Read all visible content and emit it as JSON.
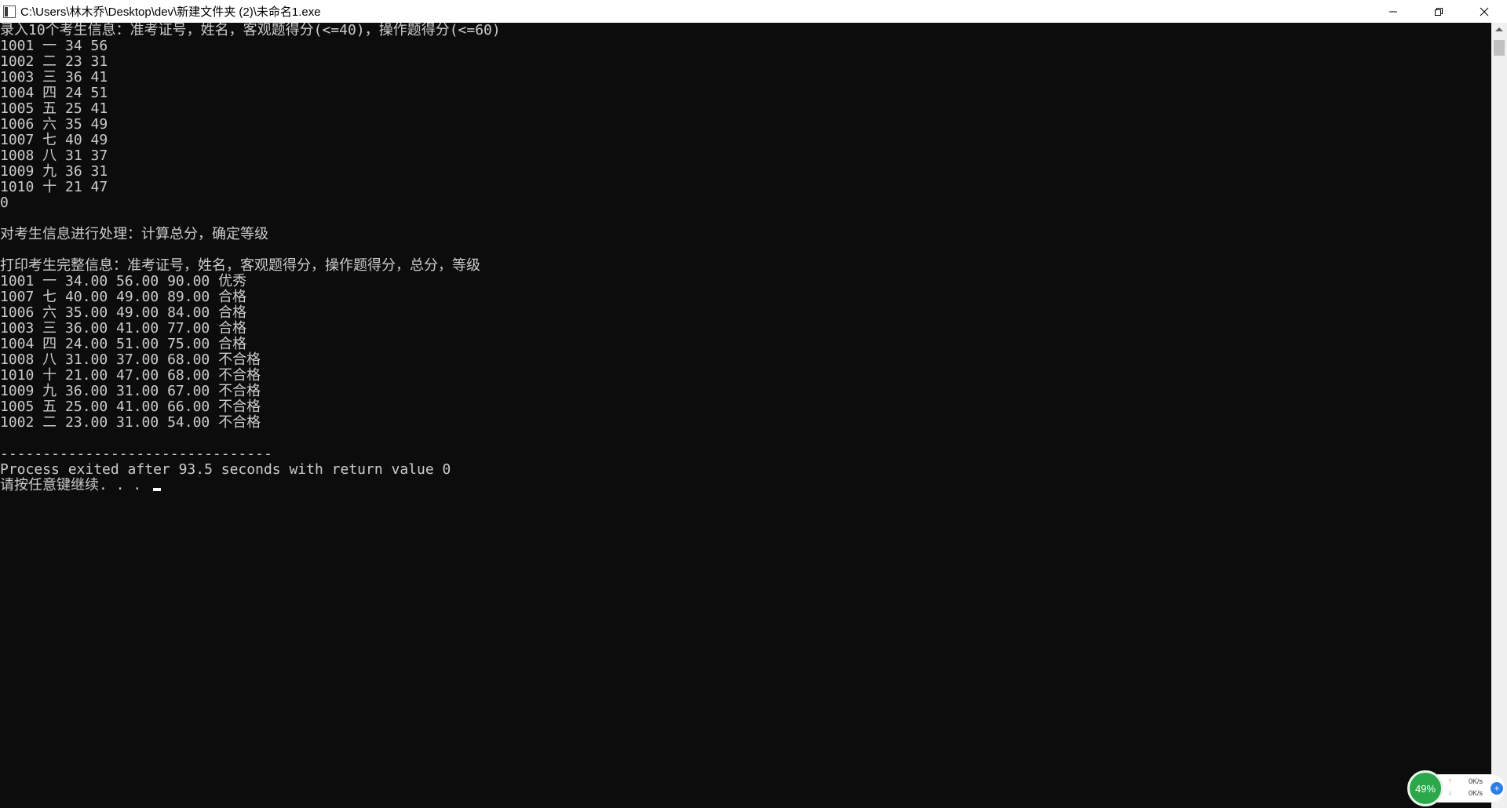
{
  "window": {
    "title": "C:\\Users\\林木乔\\Desktop\\dev\\新建文件夹 (2)\\未命名1.exe",
    "controls": {
      "minimize": "minimize-icon",
      "maximize": "restore-icon",
      "close": "close-icon"
    }
  },
  "console": {
    "lines": [
      "录入10个考生信息：准考证号，姓名，客观题得分(<=40)，操作题得分(<=60)",
      "1001 一 34 56",
      "1002 二 23 31",
      "1003 三 36 41",
      "1004 四 24 51",
      "1005 五 25 41",
      "1006 六 35 49",
      "1007 七 40 49",
      "1008 八 31 37",
      "1009 九 36 31",
      "1010 十 21 47",
      "0",
      "",
      "对考生信息进行处理：计算总分，确定等级",
      "",
      "打印考生完整信息：准考证号，姓名，客观题得分，操作题得分，总分，等级",
      "1001 一 34.00 56.00 90.00 优秀",
      "1007 七 40.00 49.00 89.00 合格",
      "1006 六 35.00 49.00 84.00 合格",
      "1003 三 36.00 41.00 77.00 合格",
      "1004 四 24.00 51.00 75.00 合格",
      "1008 八 31.00 37.00 68.00 不合格",
      "1010 十 21.00 47.00 68.00 不合格",
      "1009 九 36.00 31.00 67.00 不合格",
      "1005 五 25.00 41.00 66.00 不合格",
      "1002 二 23.00 31.00 54.00 不合格",
      "",
      "--------------------------------",
      "Process exited after 93.5 seconds with return value 0",
      "请按任意键继续. . . "
    ]
  },
  "net_widget": {
    "percent": "49%",
    "up_speed": "0K/s",
    "down_speed": "0K/s",
    "up_arrow": "↑",
    "down_arrow": "↓",
    "plus": "+"
  },
  "colors": {
    "console_bg": "#0c0c0c",
    "console_text": "#cccccc",
    "titlebar_bg": "#ffffff",
    "widget_green": "#2aa84a"
  }
}
